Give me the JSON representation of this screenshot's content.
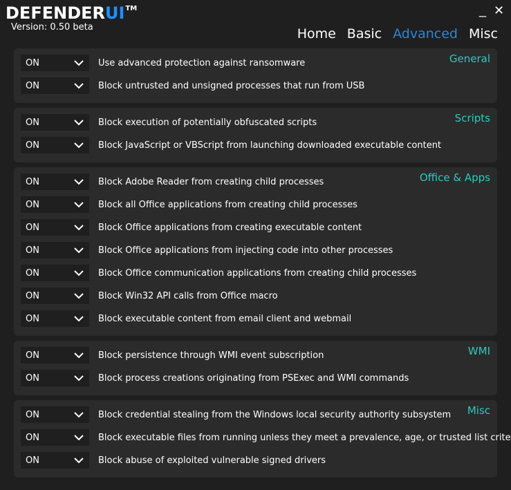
{
  "app": {
    "logo_main": "DEFENDER",
    "logo_accent": "UI",
    "logo_tm": "TM",
    "version": "Version: 0.50 beta",
    "minimize_glyph": "_",
    "close_glyph": "✕",
    "accent_color": "#1e8fff",
    "section_title_color": "#2ec8c0"
  },
  "nav": [
    {
      "label": "Home",
      "active": false
    },
    {
      "label": "Basic",
      "active": false
    },
    {
      "label": "Advanced",
      "active": true
    },
    {
      "label": "Misc",
      "active": false
    }
  ],
  "sections": [
    {
      "title": "General",
      "rules": [
        {
          "value": "ON",
          "label": "Use advanced protection against ransomware"
        },
        {
          "value": "ON",
          "label": "Block untrusted and unsigned processes that run from USB"
        }
      ]
    },
    {
      "title": "Scripts",
      "rules": [
        {
          "value": "ON",
          "label": "Block execution of potentially obfuscated scripts"
        },
        {
          "value": "ON",
          "label": "Block JavaScript or VBScript from launching downloaded executable content"
        }
      ]
    },
    {
      "title": "Office & Apps",
      "rules": [
        {
          "value": "ON",
          "label": "Block Adobe Reader from creating child processes"
        },
        {
          "value": "ON",
          "label": "Block all Office applications from creating child processes"
        },
        {
          "value": "ON",
          "label": "Block Office applications from creating executable content"
        },
        {
          "value": "ON",
          "label": "Block Office applications from injecting code into other processes"
        },
        {
          "value": "ON",
          "label": "Block Office communication applications from creating child processes"
        },
        {
          "value": "ON",
          "label": "Block Win32 API calls from Office macro"
        },
        {
          "value": "ON",
          "label": "Block executable content from email client and webmail"
        }
      ]
    },
    {
      "title": "WMI",
      "rules": [
        {
          "value": "ON",
          "label": "Block persistence through WMI event subscription"
        },
        {
          "value": "ON",
          "label": "Block process creations originating from PSExec and WMI commands"
        }
      ]
    },
    {
      "title": "Misc",
      "rules": [
        {
          "value": "ON",
          "label": "Block credential stealing from the Windows local security authority subsystem"
        },
        {
          "value": "ON",
          "label": "Block executable files from running unless they meet a prevalence, age, or trusted list criteria"
        },
        {
          "value": "ON",
          "label": "Block abuse of exploited vulnerable signed drivers"
        }
      ]
    }
  ]
}
